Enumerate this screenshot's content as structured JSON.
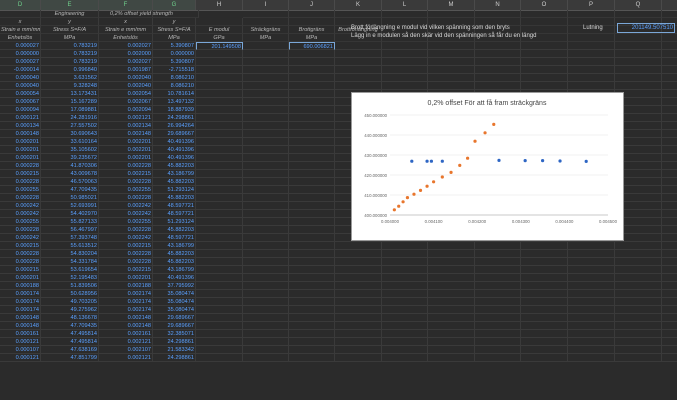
{
  "columns": [
    {
      "letter": "D",
      "w": 41,
      "sel": true
    },
    {
      "letter": "E",
      "w": 58,
      "sel": true
    },
    {
      "letter": "F",
      "w": 54,
      "sel": true
    },
    {
      "letter": "G",
      "w": 43,
      "sel": true
    },
    {
      "letter": "H",
      "w": 47
    },
    {
      "letter": "I",
      "w": 46
    },
    {
      "letter": "J",
      "w": 46
    },
    {
      "letter": "K",
      "w": 47
    },
    {
      "letter": "L",
      "w": 46
    },
    {
      "letter": "M",
      "w": 47
    },
    {
      "letter": "N",
      "w": 46
    },
    {
      "letter": "O",
      "w": 47
    },
    {
      "letter": "P",
      "w": 47
    },
    {
      "letter": "Q",
      "w": 47
    },
    {
      "letter": "R",
      "w": 47
    },
    {
      "letter": "S",
      "w": 60
    }
  ],
  "header_rows": {
    "row1": {
      "engineering": "Engineering",
      "offset": "0,2% offset yield strength"
    },
    "row2": {
      "x1": "x",
      "y1": "y",
      "x2": "x",
      "y2": "y"
    },
    "row3": {
      "d": "Strain e mm/mm",
      "e": "Stress S=F/A",
      "f": "Strain e mm/mm",
      "g": "Stress S=F/A",
      "h": "E modul",
      "i": "Sträckgräns",
      "j": "Brottgräns",
      "k": "Brottförlängning"
    },
    "row4": {
      "d": "Enhetslös",
      "e": "MPa",
      "f": "Enhetslös",
      "g": "MPa",
      "h": "GPa",
      "i": "MPa",
      "j": "MPa"
    }
  },
  "values": {
    "e_modul": "201.149508",
    "brottgrans": "690.006821",
    "lutning_label": "Lutning",
    "lutning_value": "201149.507510"
  },
  "notes": {
    "line1": "Brott förlängning e modul vid vilken spänning som den bryts",
    "line2": "Lägg in e modulen så den skär vid den spänningen så får du en längd"
  },
  "rows": [
    [
      "0.000027",
      "0.783219",
      "0.002027",
      "5.390807"
    ],
    [
      "0.000000",
      "0.783219",
      "0.002000",
      "0.000000"
    ],
    [
      "0.000027",
      "0.783219",
      "0.002027",
      "5.390807"
    ],
    [
      "-0.000014",
      "0.996840",
      "0.001987",
      "-2.715518"
    ],
    [
      "0.000040",
      "3.631562",
      "0.002040",
      "8.086210"
    ],
    [
      "0.000040",
      "9.328248",
      "0.002040",
      "8.086210"
    ],
    [
      "0.000054",
      "13.173431",
      "0.002054",
      "10.781614"
    ],
    [
      "0.000067",
      "15.167289",
      "0.002067",
      "13.497132"
    ],
    [
      "0.000094",
      "17.089881",
      "0.002094",
      "18.887939"
    ],
    [
      "0.000121",
      "24.281916",
      "0.002121",
      "24.298861"
    ],
    [
      "0.000134",
      "27.557502",
      "0.002134",
      "26.994264"
    ],
    [
      "0.000148",
      "30.690643",
      "0.002148",
      "29.689667"
    ],
    [
      "0.000201",
      "33.610164",
      "0.002201",
      "40.491396"
    ],
    [
      "0.000201",
      "35.105602",
      "0.002201",
      "40.491396"
    ],
    [
      "0.000201",
      "39.235672",
      "0.002201",
      "40.491396"
    ],
    [
      "0.000228",
      "41.870306",
      "0.002228",
      "45.882203"
    ],
    [
      "0.000215",
      "43.009678",
      "0.002215",
      "43.186799"
    ],
    [
      "0.000228",
      "46.570063",
      "0.002228",
      "45.882203"
    ],
    [
      "0.000255",
      "47.709435",
      "0.002255",
      "51.293124"
    ],
    [
      "0.000228",
      "50.985021",
      "0.002228",
      "45.882203"
    ],
    [
      "0.000242",
      "52.693991",
      "0.002242",
      "48.597721"
    ],
    [
      "0.000242",
      "54.402970",
      "0.002242",
      "48.597721"
    ],
    [
      "0.000255",
      "55.827133",
      "0.002255",
      "51.293124"
    ],
    [
      "0.000228",
      "56.467997",
      "0.002228",
      "45.882203"
    ],
    [
      "0.000242",
      "57.393748",
      "0.002242",
      "48.597721"
    ],
    [
      "0.000215",
      "55.613512",
      "0.002215",
      "43.186799"
    ],
    [
      "0.000228",
      "54.830204",
      "0.002228",
      "45.882203"
    ],
    [
      "0.000228",
      "54.331784",
      "0.002228",
      "45.882203"
    ],
    [
      "0.000215",
      "53.619654",
      "0.002215",
      "43.186799"
    ],
    [
      "0.000201",
      "52.195483",
      "0.002201",
      "40.491396"
    ],
    [
      "0.000188",
      "51.839506",
      "0.002188",
      "37.795992"
    ],
    [
      "0.000174",
      "50.628956",
      "0.002174",
      "35.080474"
    ],
    [
      "0.000174",
      "49.703205",
      "0.002174",
      "35.080474"
    ],
    [
      "0.000174",
      "49.275962",
      "0.002174",
      "35.080474"
    ],
    [
      "0.000148",
      "48.136678",
      "0.002148",
      "29.689667"
    ],
    [
      "0.000148",
      "47.709435",
      "0.002148",
      "29.689667"
    ],
    [
      "0.000161",
      "47.495814",
      "0.002161",
      "32.385071"
    ],
    [
      "0.000121",
      "47.495814",
      "0.002121",
      "24.298861"
    ],
    [
      "0.000107",
      "47.638169",
      "0.002107",
      "21.583342"
    ],
    [
      "0.000121",
      "47.851799",
      "0.002121",
      "24.298861"
    ]
  ],
  "chart_data": {
    "type": "scatter",
    "title": "0,2% offset För att få fram sträckgräns",
    "xlim": [
      0.004,
      0.0045
    ],
    "ylim": [
      400,
      450
    ],
    "x_ticks": [
      "0.004000",
      "0.004100",
      "0.004200",
      "0.004300",
      "0.004400",
      "0.004500"
    ],
    "y_ticks": [
      "400.000000",
      "410.000000",
      "420.000000",
      "430.000000",
      "440.000000",
      "450.000000"
    ],
    "series": [
      {
        "color": "#e8762d",
        "points": [
          [
            0.00401,
            402.6
          ],
          [
            0.00402,
            404.4
          ],
          [
            0.00403,
            406.6
          ],
          [
            0.00404,
            408.7
          ],
          [
            0.004055,
            410.4
          ],
          [
            0.00407,
            412.3
          ],
          [
            0.004085,
            414.4
          ],
          [
            0.0041,
            416.6
          ],
          [
            0.00412,
            419.0
          ],
          [
            0.00414,
            421.3
          ],
          [
            0.00416,
            424.8
          ],
          [
            0.004178,
            428.4
          ],
          [
            0.004195,
            436.9
          ],
          [
            0.004218,
            441.1
          ],
          [
            0.004238,
            445.3
          ]
        ]
      },
      {
        "color": "#2e66c4",
        "points": [
          [
            0.00405,
            426.9
          ],
          [
            0.004085,
            426.9
          ],
          [
            0.004095,
            426.9
          ],
          [
            0.00412,
            426.9
          ],
          [
            0.00425,
            427.3
          ],
          [
            0.00431,
            427.2
          ],
          [
            0.00435,
            427.2
          ],
          [
            0.00439,
            427.0
          ],
          [
            0.00445,
            426.8
          ]
        ]
      }
    ]
  }
}
